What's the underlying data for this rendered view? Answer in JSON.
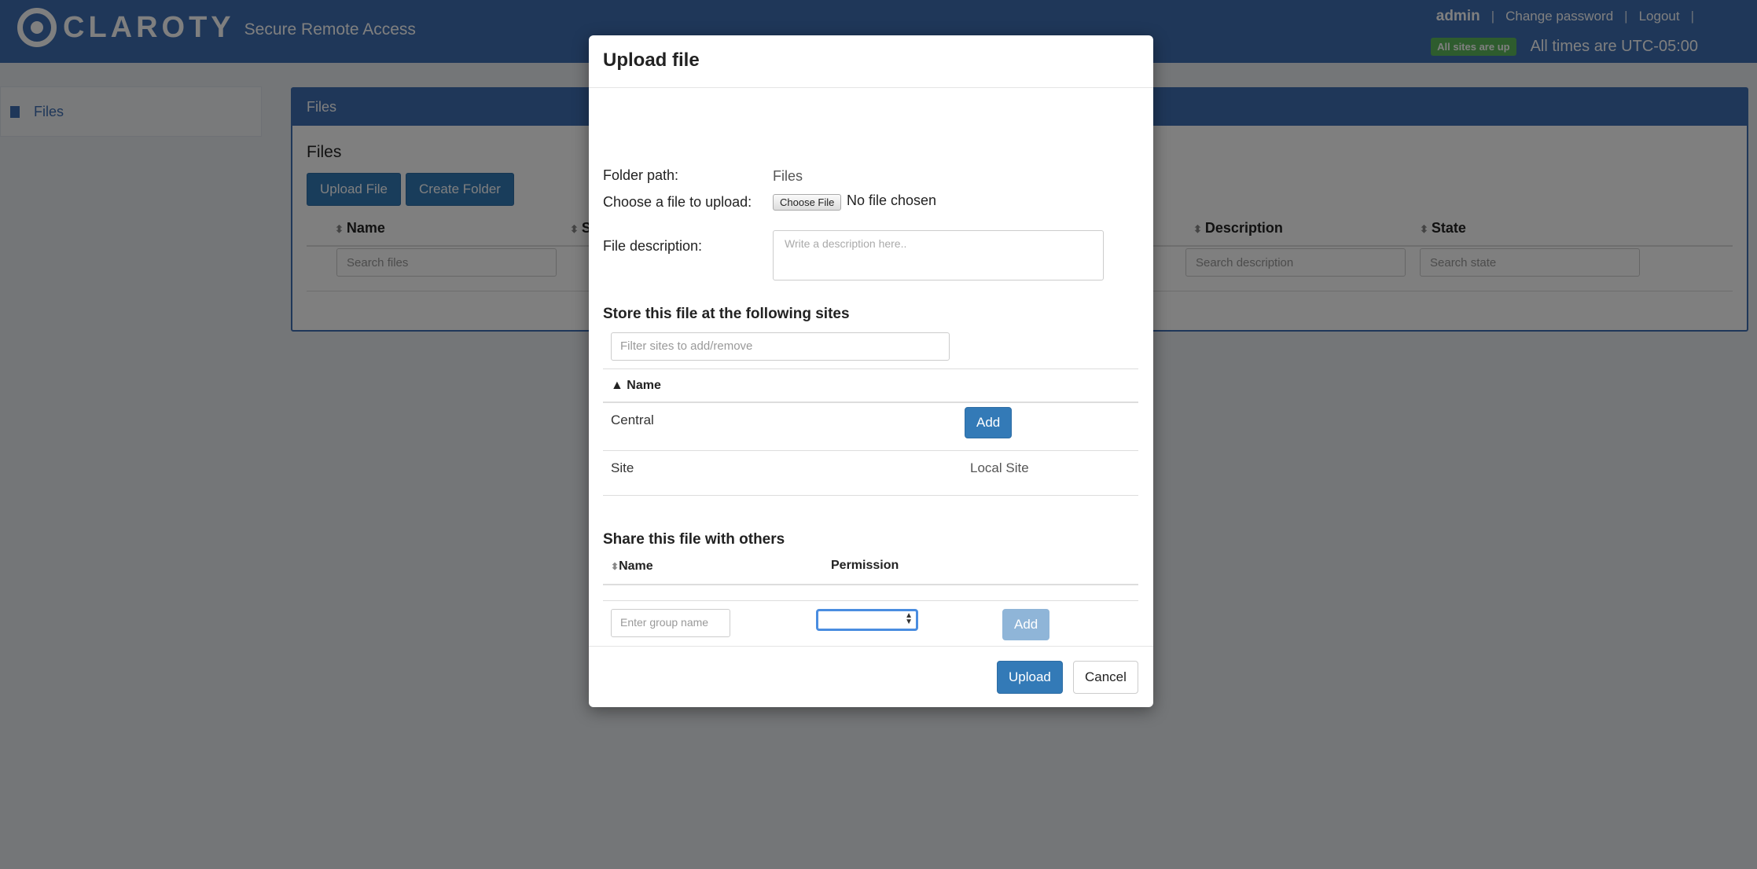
{
  "app": {
    "brand": "CLAROTY",
    "product": "Secure Remote Access",
    "user": "admin",
    "change_password": "Change password",
    "logout": "Logout",
    "sites_status": "All sites are up",
    "timezone": "All times are UTC-05:00"
  },
  "sidebar": {
    "items": [
      {
        "label": "Files"
      }
    ]
  },
  "panel": {
    "header": "Files",
    "title": "Files",
    "upload_button": "Upload File",
    "create_folder_button": "Create Folder",
    "columns": [
      "Name",
      "S",
      "Description",
      "State"
    ],
    "search": {
      "files": "Search files",
      "description": "Search description",
      "state": "Search state"
    }
  },
  "modal": {
    "title": "Upload file",
    "folder_path_label": "Folder path:",
    "folder_path_value": "Files",
    "choose_file_label": "Choose a file to upload:",
    "choose_file_button": "Choose File",
    "no_file": "No file chosen",
    "description_label": "File description:",
    "description_placeholder": "Write a description here..",
    "sites_section": "Store this file at the following sites",
    "sites_filter_placeholder": "Filter sites to add/remove",
    "sites_col_name": "▲ Name",
    "sites": [
      {
        "name": "Central",
        "action": "Add"
      },
      {
        "name": "Site",
        "status": "Local Site"
      }
    ],
    "share_section": "Share this file with others",
    "share_col_name": "Name",
    "share_col_permission": "Permission",
    "group_placeholder": "Enter group name",
    "share_add": "Add",
    "upload_button": "Upload",
    "cancel_button": "Cancel"
  }
}
